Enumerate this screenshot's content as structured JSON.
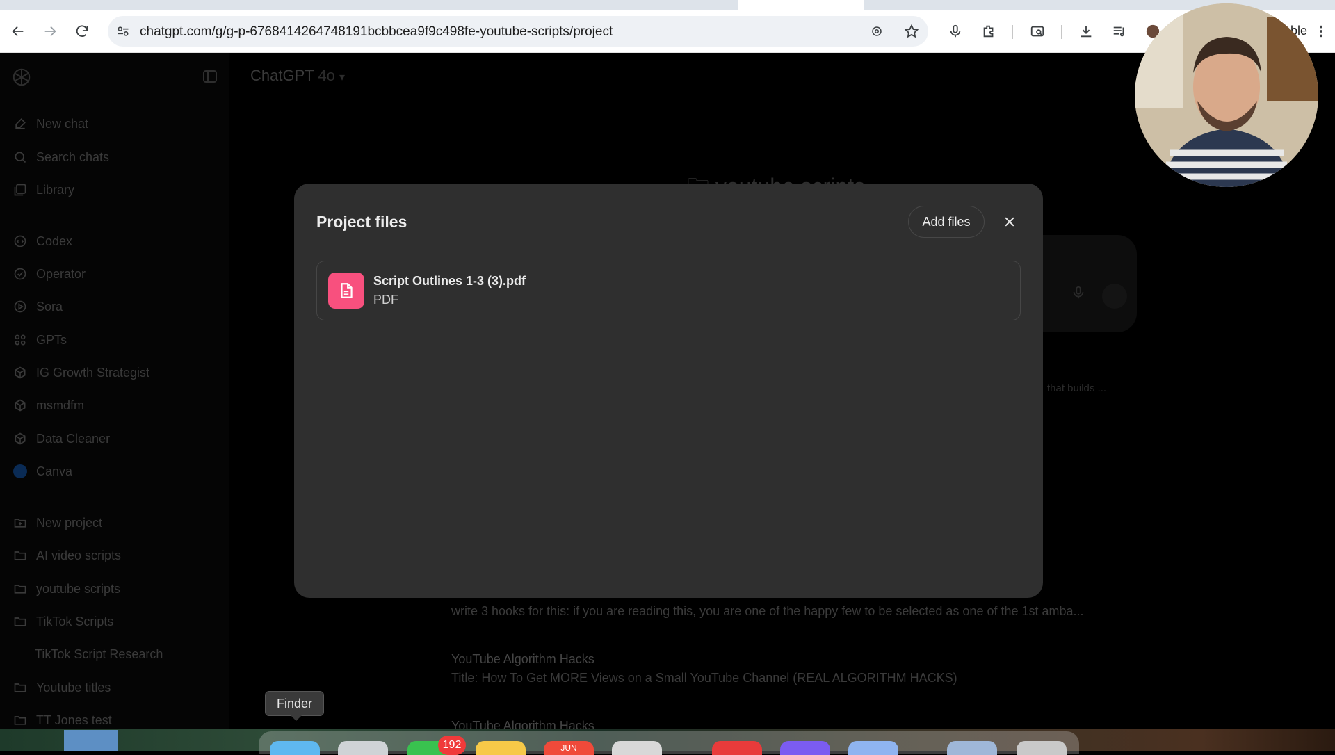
{
  "browser": {
    "url": "chatgpt.com/g/g-p-6768414264748191bcbbcea9f9c498fe-youtube-scripts/project",
    "profile_label": "ble"
  },
  "app": {
    "model_name": "ChatGPT",
    "model_version": "4o",
    "project_title": "youtube scripts",
    "faint_text": "that builds ..."
  },
  "sidebar": {
    "top_items": [
      {
        "label": "New chat",
        "icon": "compose-icon"
      },
      {
        "label": "Search chats",
        "icon": "search-icon"
      },
      {
        "label": "Library",
        "icon": "library-icon"
      }
    ],
    "gpt_items": [
      {
        "label": "Codex",
        "icon": "codex-icon"
      },
      {
        "label": "Operator",
        "icon": "operator-icon"
      },
      {
        "label": "Sora",
        "icon": "sora-icon"
      },
      {
        "label": "GPTs",
        "icon": "grid-icon"
      },
      {
        "label": "IG Growth Strategist",
        "icon": "cube-icon"
      },
      {
        "label": "msmdfm",
        "icon": "cube-icon"
      },
      {
        "label": "Data Cleaner",
        "icon": "cube-icon"
      },
      {
        "label": "Canva",
        "icon": "canva-icon"
      }
    ],
    "project_items": [
      {
        "label": "New project",
        "icon": "new-folder-icon"
      },
      {
        "label": "AI video scripts",
        "icon": "folder-icon"
      },
      {
        "label": "youtube scripts",
        "icon": "folder-icon"
      },
      {
        "label": "TikTok Scripts",
        "icon": "folder-icon"
      },
      {
        "label": "TikTok Script Research",
        "icon": ""
      },
      {
        "label": "Youtube titles",
        "icon": "folder-icon"
      },
      {
        "label": "TT Jones test",
        "icon": "folder-icon"
      }
    ]
  },
  "chats": [
    {
      "title": "",
      "subtitle": "write 3 hooks for this: if you are reading this, you are one of the happy few to be selected as one of the 1st amba..."
    },
    {
      "title": "YouTube Algorithm Hacks",
      "subtitle": "Title: How To Get MORE Views on a Small YouTube Channel (REAL ALGORITHM HACKS)"
    },
    {
      "title": "YouTube Algorithm Hacks",
      "subtitle": ""
    }
  ],
  "modal": {
    "title": "Project files",
    "add_files_label": "Add files",
    "files": [
      {
        "name": "Script Outlines 1-3 (3).pdf",
        "type": "PDF",
        "icon": "document-icon",
        "icon_color": "#f8507e"
      }
    ]
  },
  "tooltip": {
    "label": "Finder"
  },
  "dock": {
    "badge_count": "192",
    "calendar_month": "JUN"
  }
}
